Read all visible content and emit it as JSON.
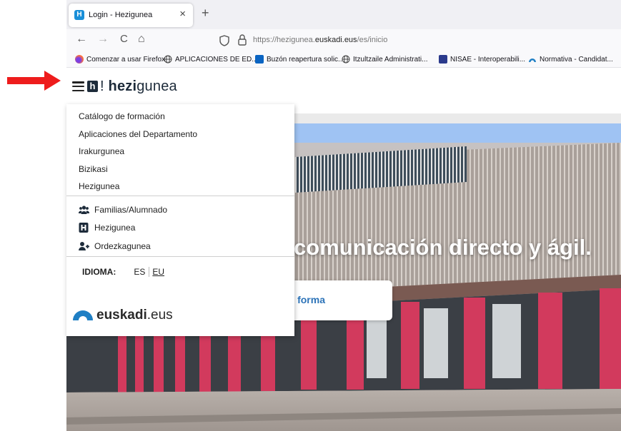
{
  "browser": {
    "tab_title": "Login - Hezigunea",
    "tab_close": "×",
    "new_tab": "+",
    "favicon_letter": "H",
    "nav": {
      "back": "←",
      "forward": "→",
      "reload": "C",
      "home": "⌂"
    },
    "url_prefix": "https://hezigunea.",
    "url_domain": "euskadi.eus",
    "url_path": "/es/inicio",
    "bookmarks": [
      "Comenzar a usar Firefox",
      "APLICACIONES DE ED...",
      "Buzón reapertura solic...",
      "Itzultzaile Administrati...",
      "NISAE - Interoperabili...",
      "Normativa - Candidat..."
    ]
  },
  "header": {
    "logo_letter": "h",
    "logo_mark": "!",
    "logo_bold": "hezi",
    "logo_rest": "gunea"
  },
  "menu": {
    "links": [
      "Catálogo de formación",
      "Aplicaciones del Departamento",
      "Irakurgunea",
      "Bizikasi",
      "Hezigunea"
    ],
    "icon_links": [
      {
        "label": "Familias/Alumnado",
        "icon": "users-icon"
      },
      {
        "label": "Hezigunea",
        "icon": "hezigunea-h-icon"
      },
      {
        "label": "Ordezkagunea",
        "icon": "user-plus-icon"
      }
    ],
    "language_label": "IDIOMA:",
    "lang_es": "ES",
    "lang_eu": "EU",
    "footer_bold": "euskadi",
    "footer_rest": ".eus"
  },
  "hero": {
    "title": "comunicación directo y ágil.",
    "card_label": "forma"
  },
  "colors": {
    "arrow": "#ee1c1c",
    "brand_dark": "#1d2b3a",
    "euskadi_blue": "#1f7fc4",
    "hero_band": "#9fc3f3",
    "pillar": "#d23a5d"
  }
}
